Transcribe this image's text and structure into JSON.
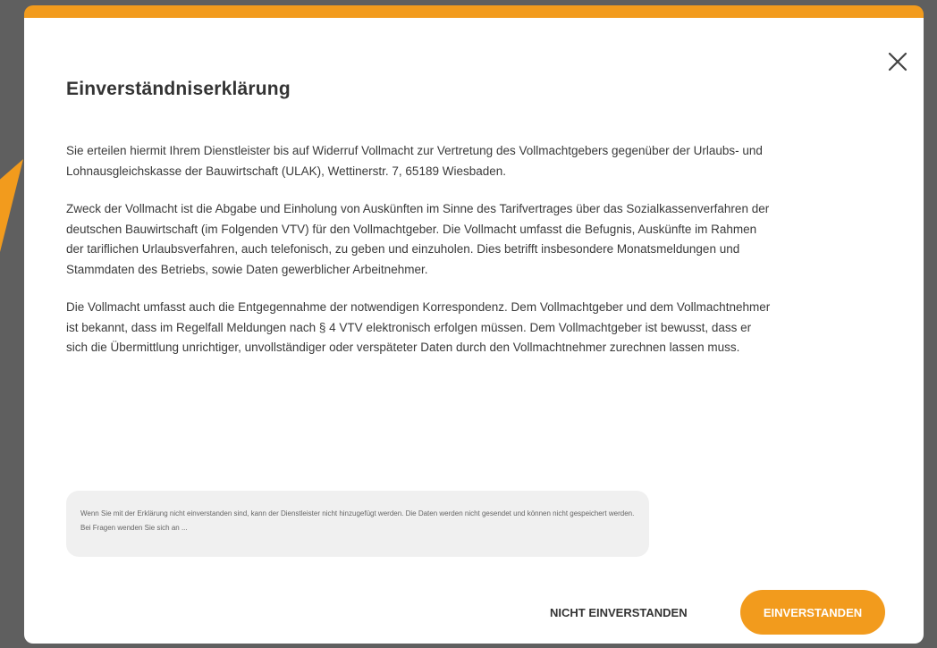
{
  "colors": {
    "accent": "#f29b1d",
    "backdrop": "#5f5f5f",
    "text": "#3a3a3a",
    "note_background": "#f0f0f0"
  },
  "dialog": {
    "title": "Einverständniserklärung",
    "close_icon": "close-icon",
    "paragraphs": [
      "Sie erteilen hiermit Ihrem Dienstleister bis auf Widerruf Vollmacht zur Vertretung des Vollmachtgebers gegenüber der Urlaubs- und Lohnausgleichskasse der Bauwirtschaft (ULAK), Wettinerstr. 7, 65189 Wiesbaden.",
      "Zweck der Vollmacht ist die Abgabe und Einholung von Auskünften im Sinne des Tarifvertrages über das Sozialkassenverfahren der deutschen Bauwirtschaft (im Folgenden VTV) für den Vollmachtgeber. Die Vollmacht umfasst die Befugnis, Auskünfte im Rahmen der tariflichen Urlaubsverfahren, auch telefonisch, zu geben und einzuholen. Dies betrifft insbesondere Monatsmeldungen und Stammdaten des Betriebs, sowie Daten gewerblicher Arbeitnehmer.",
      "Die Vollmacht umfasst auch die Entgegennahme der notwendigen Korrespondenz. Dem Vollmachtgeber und dem Vollmachtnehmer ist bekannt, dass im Regelfall Meldungen nach § 4 VTV elektronisch erfolgen müssen. Dem Vollmachtgeber ist bewusst, dass er sich die Übermittlung unrichtiger, unvollständiger oder verspäteter Daten durch den Vollmachtnehmer zurechnen lassen muss."
    ],
    "note": "Wenn Sie mit der Erklärung nicht einverstanden sind, kann der Dienstleister nicht hinzugefügt werden. Die Daten werden nicht gesendet und können nicht gespeichert werden. Bei Fragen wenden Sie sich an ...",
    "decline_label": "NICHT EINVERSTANDEN",
    "accept_label": "EINVERSTANDEN"
  }
}
